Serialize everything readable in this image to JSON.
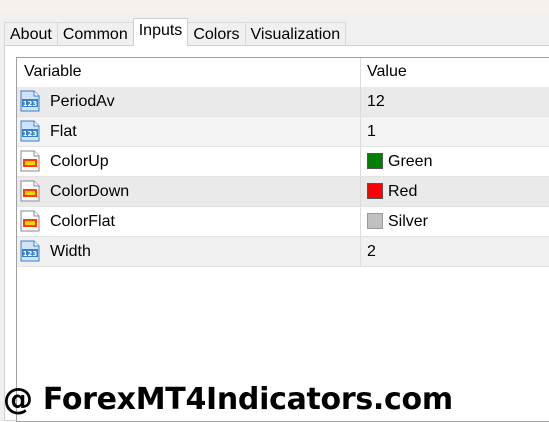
{
  "tabs": [
    {
      "label": "About",
      "active": false
    },
    {
      "label": "Common",
      "active": false
    },
    {
      "label": "Inputs",
      "active": true
    },
    {
      "label": "Colors",
      "active": false
    },
    {
      "label": "Visualization",
      "active": false
    }
  ],
  "grid": {
    "headers": {
      "variable": "Variable",
      "value": "Value"
    },
    "rows": [
      {
        "name": "PeriodAv",
        "value": "12",
        "icon": "integer-param-icon"
      },
      {
        "name": "Flat",
        "value": "1",
        "icon": "integer-param-icon"
      },
      {
        "name": "ColorUp",
        "value": "Green",
        "icon": "color-param-icon",
        "color": "#008000"
      },
      {
        "name": "ColorDown",
        "value": "Red",
        "icon": "color-param-icon",
        "color": "#ff0000"
      },
      {
        "name": "ColorFlat",
        "value": "Silver",
        "icon": "color-param-icon",
        "color": "#c0c0c0"
      },
      {
        "name": "Width",
        "value": "2",
        "icon": "integer-param-icon"
      }
    ]
  },
  "watermark": "@ ForexMT4Indicators.com",
  "colors": {
    "integer_icon": "#3b7fc9",
    "color_icon_accent": "#ff3b00",
    "color_icon_fill": "#f6d600"
  }
}
